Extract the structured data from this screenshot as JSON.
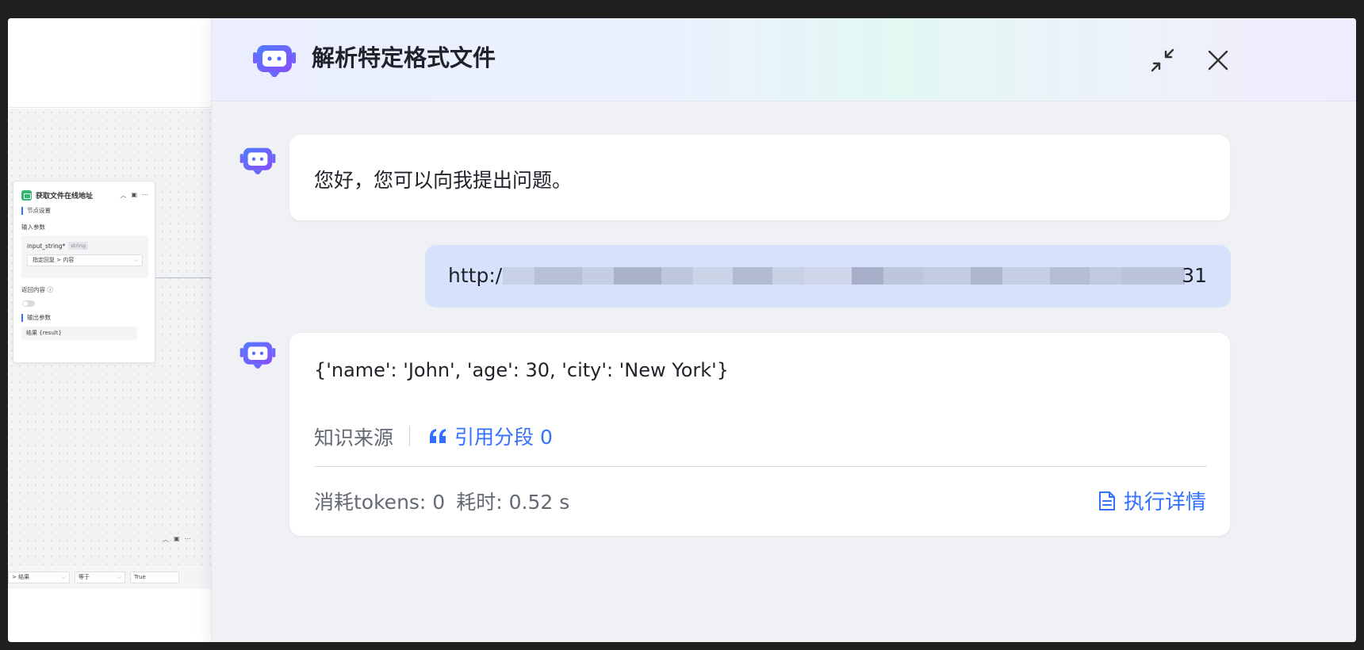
{
  "editor": {
    "node": {
      "title": "获取文件在线地址",
      "section_node_settings": "节点设置",
      "input_params_label": "输入参数",
      "param_name": "input_string*",
      "param_type": "string",
      "param_select_value": "指定回复 > 内容",
      "return_content_label": "返回内容 ⓘ",
      "output_params_label": "输出参数",
      "output_value": "结果 {result}"
    },
    "condition": {
      "field_value": "> 结果",
      "operator": "等于",
      "value": "True"
    }
  },
  "drawer": {
    "title": "解析特定格式文件",
    "messages": {
      "greeting": "您好，您可以向我提出问题。",
      "user_url_prefix": "http:/",
      "user_url_suffix": "31",
      "answer_text": "{'name': 'John', 'age': 30, 'city': 'New York'}",
      "source_label": "知识来源",
      "cite_label": "引用分段 0",
      "tokens_label": "消耗tokens: 0",
      "time_label": "耗时: 0.52 s",
      "detail_label": "执行详情"
    }
  },
  "colors": {
    "accent": "#3370ff",
    "bot_avatar_gradient": [
      "#4f7dff",
      "#8a4dff"
    ],
    "user_bubble": "#d6e1fc"
  }
}
